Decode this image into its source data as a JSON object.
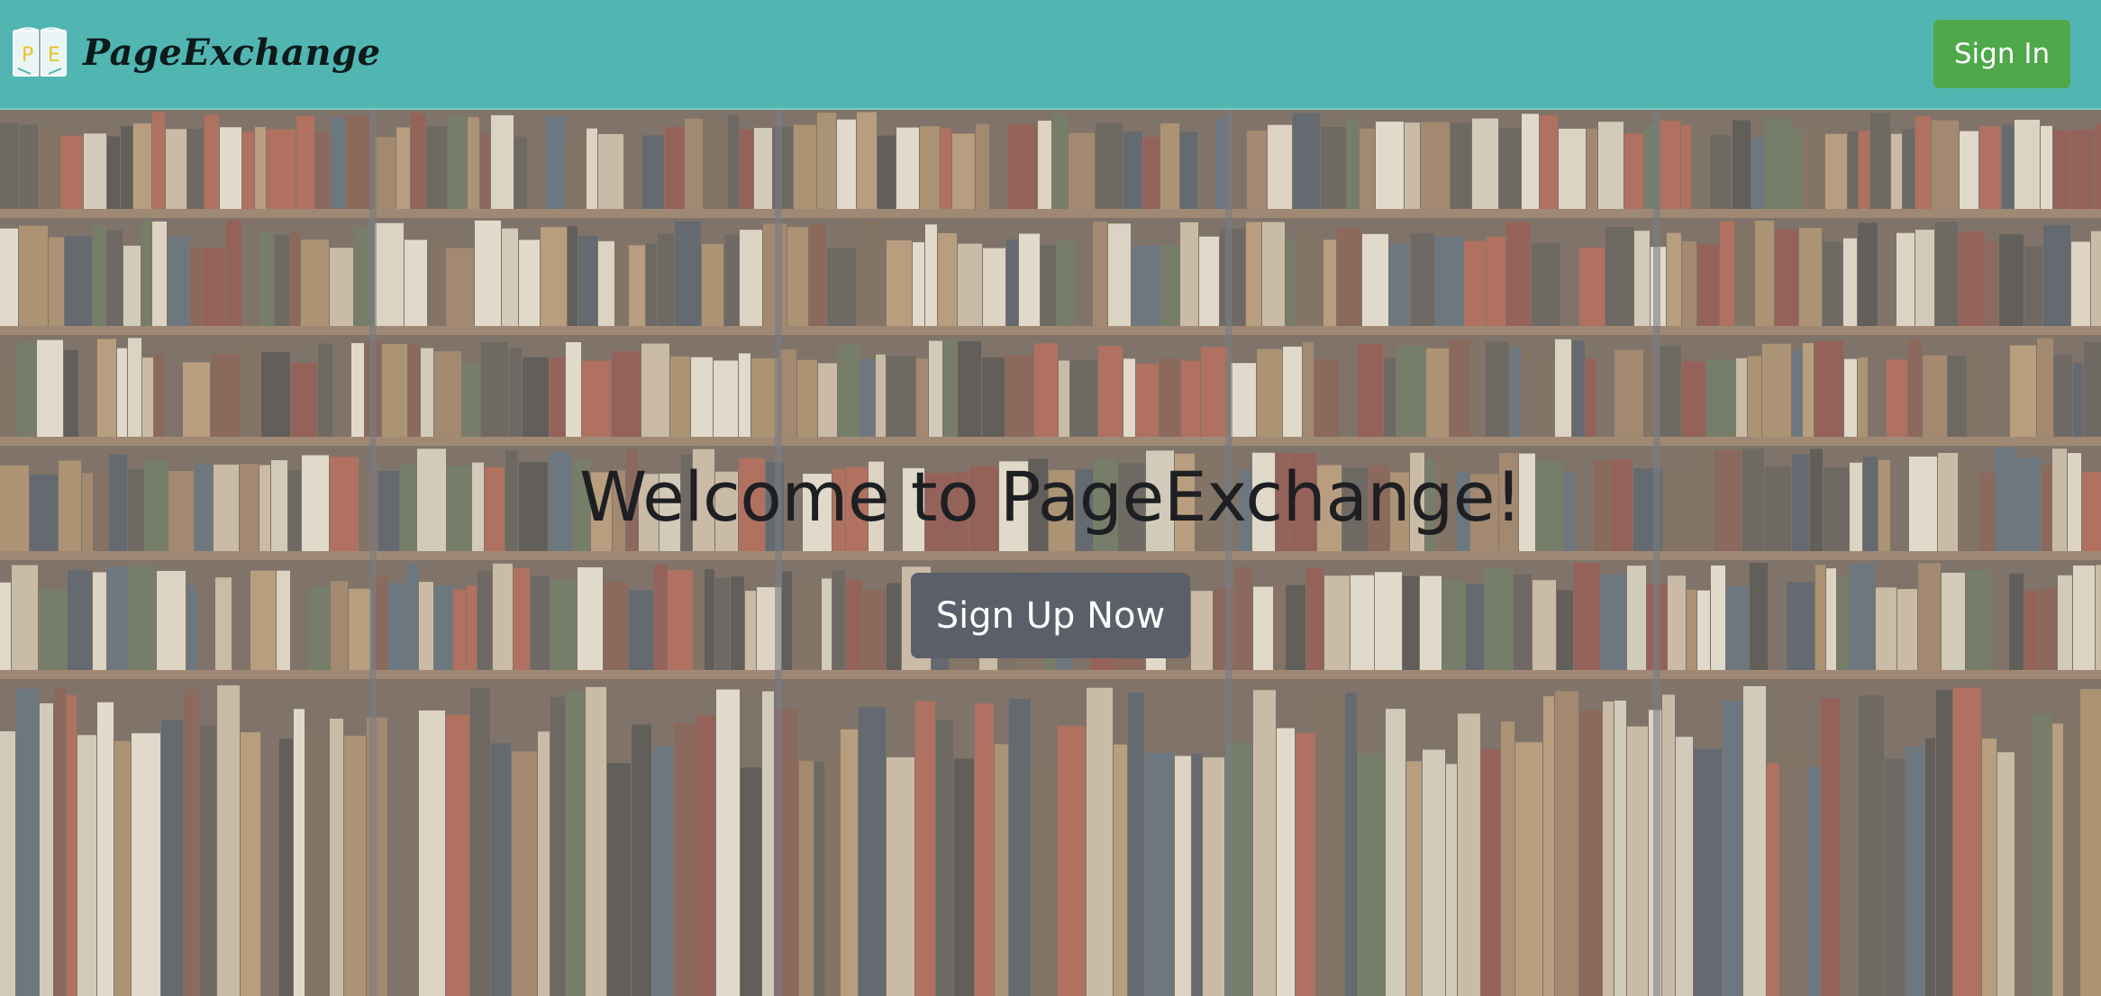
{
  "navbar": {
    "brand_name": "PageExchange",
    "logo_letters": [
      "P",
      "E"
    ],
    "signin_label": "Sign In",
    "background_color": "#51b6b2",
    "signin_color": "#4fa84a"
  },
  "hero": {
    "title": "Welcome to PageExchange!",
    "signup_label": "Sign Up Now",
    "signup_color": "#5b5f69",
    "background": "bookshelf-photo"
  },
  "icons": {
    "logo": "open-book-icon"
  }
}
